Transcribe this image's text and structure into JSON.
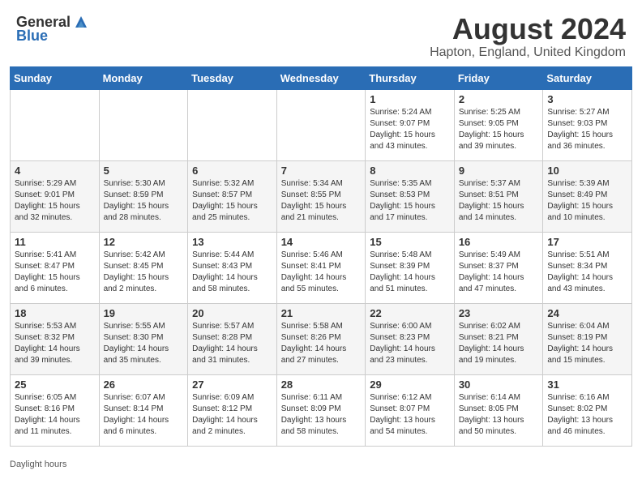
{
  "header": {
    "logo_general": "General",
    "logo_blue": "Blue",
    "month_year": "August 2024",
    "location": "Hapton, England, United Kingdom"
  },
  "days_of_week": [
    "Sunday",
    "Monday",
    "Tuesday",
    "Wednesday",
    "Thursday",
    "Friday",
    "Saturday"
  ],
  "weeks": [
    [
      {
        "day": "",
        "info": ""
      },
      {
        "day": "",
        "info": ""
      },
      {
        "day": "",
        "info": ""
      },
      {
        "day": "",
        "info": ""
      },
      {
        "day": "1",
        "info": "Sunrise: 5:24 AM\nSunset: 9:07 PM\nDaylight: 15 hours\nand 43 minutes."
      },
      {
        "day": "2",
        "info": "Sunrise: 5:25 AM\nSunset: 9:05 PM\nDaylight: 15 hours\nand 39 minutes."
      },
      {
        "day": "3",
        "info": "Sunrise: 5:27 AM\nSunset: 9:03 PM\nDaylight: 15 hours\nand 36 minutes."
      }
    ],
    [
      {
        "day": "4",
        "info": "Sunrise: 5:29 AM\nSunset: 9:01 PM\nDaylight: 15 hours\nand 32 minutes."
      },
      {
        "day": "5",
        "info": "Sunrise: 5:30 AM\nSunset: 8:59 PM\nDaylight: 15 hours\nand 28 minutes."
      },
      {
        "day": "6",
        "info": "Sunrise: 5:32 AM\nSunset: 8:57 PM\nDaylight: 15 hours\nand 25 minutes."
      },
      {
        "day": "7",
        "info": "Sunrise: 5:34 AM\nSunset: 8:55 PM\nDaylight: 15 hours\nand 21 minutes."
      },
      {
        "day": "8",
        "info": "Sunrise: 5:35 AM\nSunset: 8:53 PM\nDaylight: 15 hours\nand 17 minutes."
      },
      {
        "day": "9",
        "info": "Sunrise: 5:37 AM\nSunset: 8:51 PM\nDaylight: 15 hours\nand 14 minutes."
      },
      {
        "day": "10",
        "info": "Sunrise: 5:39 AM\nSunset: 8:49 PM\nDaylight: 15 hours\nand 10 minutes."
      }
    ],
    [
      {
        "day": "11",
        "info": "Sunrise: 5:41 AM\nSunset: 8:47 PM\nDaylight: 15 hours\nand 6 minutes."
      },
      {
        "day": "12",
        "info": "Sunrise: 5:42 AM\nSunset: 8:45 PM\nDaylight: 15 hours\nand 2 minutes."
      },
      {
        "day": "13",
        "info": "Sunrise: 5:44 AM\nSunset: 8:43 PM\nDaylight: 14 hours\nand 58 minutes."
      },
      {
        "day": "14",
        "info": "Sunrise: 5:46 AM\nSunset: 8:41 PM\nDaylight: 14 hours\nand 55 minutes."
      },
      {
        "day": "15",
        "info": "Sunrise: 5:48 AM\nSunset: 8:39 PM\nDaylight: 14 hours\nand 51 minutes."
      },
      {
        "day": "16",
        "info": "Sunrise: 5:49 AM\nSunset: 8:37 PM\nDaylight: 14 hours\nand 47 minutes."
      },
      {
        "day": "17",
        "info": "Sunrise: 5:51 AM\nSunset: 8:34 PM\nDaylight: 14 hours\nand 43 minutes."
      }
    ],
    [
      {
        "day": "18",
        "info": "Sunrise: 5:53 AM\nSunset: 8:32 PM\nDaylight: 14 hours\nand 39 minutes."
      },
      {
        "day": "19",
        "info": "Sunrise: 5:55 AM\nSunset: 8:30 PM\nDaylight: 14 hours\nand 35 minutes."
      },
      {
        "day": "20",
        "info": "Sunrise: 5:57 AM\nSunset: 8:28 PM\nDaylight: 14 hours\nand 31 minutes."
      },
      {
        "day": "21",
        "info": "Sunrise: 5:58 AM\nSunset: 8:26 PM\nDaylight: 14 hours\nand 27 minutes."
      },
      {
        "day": "22",
        "info": "Sunrise: 6:00 AM\nSunset: 8:23 PM\nDaylight: 14 hours\nand 23 minutes."
      },
      {
        "day": "23",
        "info": "Sunrise: 6:02 AM\nSunset: 8:21 PM\nDaylight: 14 hours\nand 19 minutes."
      },
      {
        "day": "24",
        "info": "Sunrise: 6:04 AM\nSunset: 8:19 PM\nDaylight: 14 hours\nand 15 minutes."
      }
    ],
    [
      {
        "day": "25",
        "info": "Sunrise: 6:05 AM\nSunset: 8:16 PM\nDaylight: 14 hours\nand 11 minutes."
      },
      {
        "day": "26",
        "info": "Sunrise: 6:07 AM\nSunset: 8:14 PM\nDaylight: 14 hours\nand 6 minutes."
      },
      {
        "day": "27",
        "info": "Sunrise: 6:09 AM\nSunset: 8:12 PM\nDaylight: 14 hours\nand 2 minutes."
      },
      {
        "day": "28",
        "info": "Sunrise: 6:11 AM\nSunset: 8:09 PM\nDaylight: 13 hours\nand 58 minutes."
      },
      {
        "day": "29",
        "info": "Sunrise: 6:12 AM\nSunset: 8:07 PM\nDaylight: 13 hours\nand 54 minutes."
      },
      {
        "day": "30",
        "info": "Sunrise: 6:14 AM\nSunset: 8:05 PM\nDaylight: 13 hours\nand 50 minutes."
      },
      {
        "day": "31",
        "info": "Sunrise: 6:16 AM\nSunset: 8:02 PM\nDaylight: 13 hours\nand 46 minutes."
      }
    ]
  ],
  "footer": {
    "daylight_label": "Daylight hours"
  }
}
